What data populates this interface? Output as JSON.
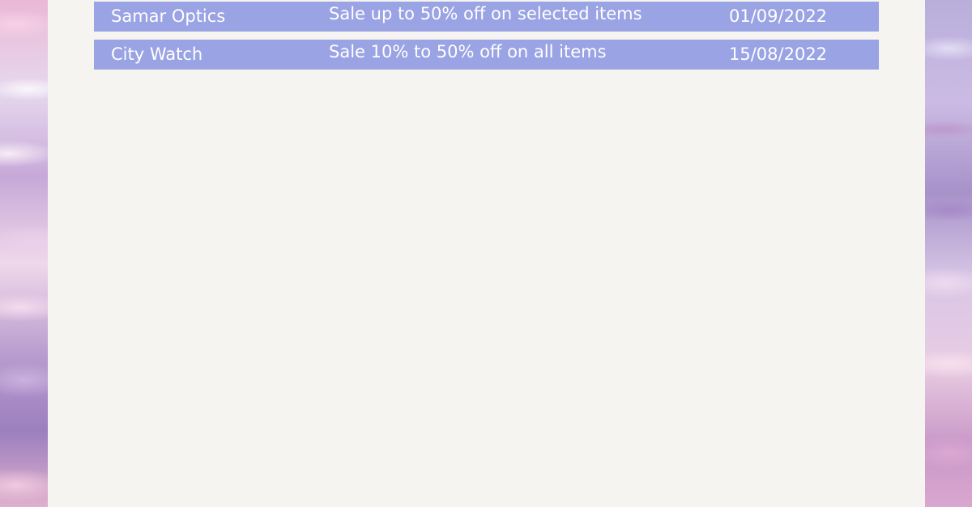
{
  "colors": {
    "panel_background": "#f5f4f0",
    "row_background": "#9aa3e3",
    "row_text": "#ffffff"
  },
  "sales_table": {
    "rows": [
      {
        "store": "Samar Optics",
        "offer": "Sale up to 50% off on selected items",
        "date": "01/09/2022"
      },
      {
        "store": "City Watch",
        "offer": "Sale 10% to 50% off on all items",
        "date": "15/08/2022"
      }
    ]
  }
}
